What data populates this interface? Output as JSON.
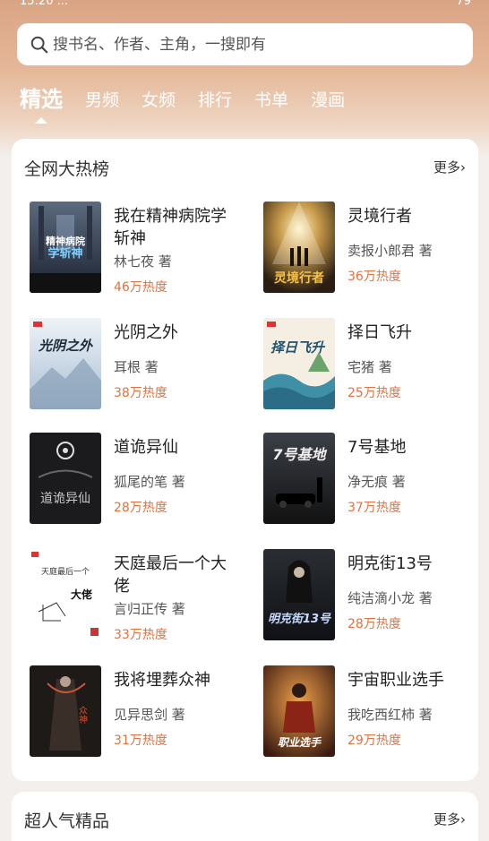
{
  "status": {
    "time": "15:20 ...",
    "signal": "79"
  },
  "search": {
    "placeholder": "搜书名、作者、主角，一搜即有"
  },
  "tabs": [
    {
      "label": "精选"
    },
    {
      "label": "男频"
    },
    {
      "label": "女频"
    },
    {
      "label": "排行"
    },
    {
      "label": "书单"
    },
    {
      "label": "漫画"
    }
  ],
  "hot_list": {
    "title": "全网大热榜",
    "more": "更多",
    "books": [
      {
        "title": "我在精神病院学斩神",
        "author": "林七夜 著",
        "heat": "46万热度",
        "cover_text": "我在精神病院学斩神"
      },
      {
        "title": "灵境行者",
        "author": "卖报小郎君 著",
        "heat": "36万热度",
        "cover_text": "灵境行者"
      },
      {
        "title": "光阴之外",
        "author": "耳根 著",
        "heat": "38万热度",
        "cover_text": "光阴之外"
      },
      {
        "title": "择日飞升",
        "author": "宅猪 著",
        "heat": "25万热度",
        "cover_text": "择日飞升"
      },
      {
        "title": "道诡异仙",
        "author": "狐尾的笔 著",
        "heat": "28万热度",
        "cover_text": "道诡异仙"
      },
      {
        "title": "7号基地",
        "author": "净无痕 著",
        "heat": "37万热度",
        "cover_text": "7号基地"
      },
      {
        "title": "天庭最后一个大佬",
        "author": "言归正传 著",
        "heat": "33万热度",
        "cover_text": "天庭最后一个大佬"
      },
      {
        "title": "明克街13号",
        "author": "纯洁滴小龙 著",
        "heat": "28万热度",
        "cover_text": "明克街13号"
      },
      {
        "title": "我将埋葬众神",
        "author": "见异思剑 著",
        "heat": "31万热度",
        "cover_text": "我将埋葬众神"
      },
      {
        "title": "宇宙职业选手",
        "author": "我吃西红柿 著",
        "heat": "29万热度",
        "cover_text": "宇宙职业选手"
      }
    ]
  },
  "popular": {
    "title": "超人气精品",
    "more": "更多"
  },
  "colors": {
    "accent_heat": "#e0733f",
    "header": "#d9a484"
  }
}
